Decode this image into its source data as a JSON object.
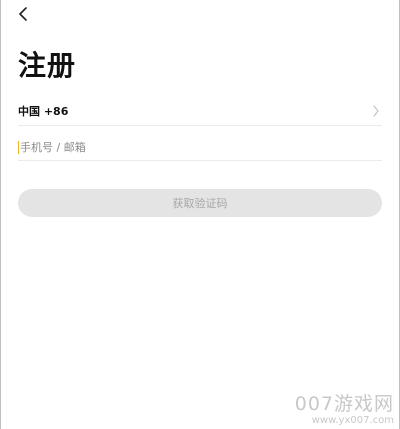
{
  "header": {
    "back_icon": "chevron-left-icon"
  },
  "page": {
    "title": "注册"
  },
  "country_selector": {
    "label": "中国 +86",
    "chevron_icon": "chevron-right-icon"
  },
  "account_input": {
    "value": "",
    "placeholder": "手机号 / 邮箱"
  },
  "get_code_button": {
    "label": "获取验证码",
    "state": "disabled"
  },
  "watermark": {
    "main": "007游戏网",
    "url": "www.yx007.com"
  },
  "colors": {
    "background": "#ffffff",
    "title": "#111111",
    "button_bg": "#e4e4e4",
    "button_text": "#a6a6a6",
    "cursor": "#f0b429",
    "divider": "#ebebeb"
  }
}
